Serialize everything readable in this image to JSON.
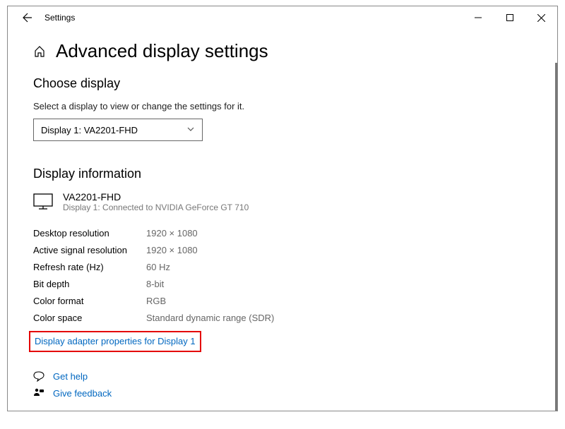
{
  "window": {
    "title": "Settings"
  },
  "page": {
    "heading": "Advanced display settings"
  },
  "choose": {
    "heading": "Choose display",
    "hint": "Select a display to view or change the settings for it.",
    "selected": "Display 1: VA2201-FHD"
  },
  "info": {
    "heading": "Display information",
    "monitor_name": "VA2201-FHD",
    "monitor_sub": "Display 1: Connected to NVIDIA GeForce GT 710",
    "rows": [
      {
        "label": "Desktop resolution",
        "value": "1920 × 1080"
      },
      {
        "label": "Active signal resolution",
        "value": "1920 × 1080"
      },
      {
        "label": "Refresh rate (Hz)",
        "value": "60 Hz"
      },
      {
        "label": "Bit depth",
        "value": "8-bit"
      },
      {
        "label": "Color format",
        "value": "RGB"
      },
      {
        "label": "Color space",
        "value": "Standard dynamic range (SDR)"
      }
    ],
    "adapter_link": "Display adapter properties for Display 1"
  },
  "footer": {
    "help": "Get help",
    "feedback": "Give feedback"
  }
}
